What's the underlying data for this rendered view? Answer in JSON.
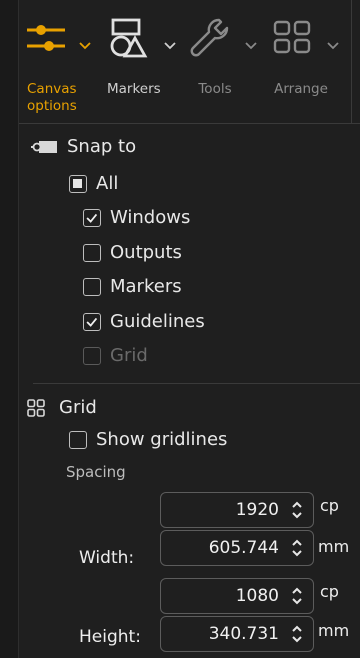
{
  "toolbar": {
    "canvas_options_label": "Canvas\noptions",
    "markers_label": "Markers",
    "tools_label": "Tools",
    "arrange_label": "Arrange",
    "accent_color": "#e8a100"
  },
  "snap": {
    "title": "Snap to",
    "items": [
      {
        "label": "All",
        "state": "indeterminate"
      },
      {
        "label": "Windows",
        "state": "checked"
      },
      {
        "label": "Outputs",
        "state": "unchecked"
      },
      {
        "label": "Markers",
        "state": "unchecked"
      },
      {
        "label": "Guidelines",
        "state": "checked"
      },
      {
        "label": "Grid",
        "state": "disabled"
      }
    ]
  },
  "grid": {
    "title": "Grid",
    "show_gridlines_label": "Show gridlines",
    "spacing_label": "Spacing",
    "width_label": "Width:",
    "height_label": "Height:",
    "width_cp": "1920",
    "width_mm": "605.744",
    "height_cp": "1080",
    "height_mm": "340.731",
    "unit_cp": "cp",
    "unit_mm": "mm"
  }
}
